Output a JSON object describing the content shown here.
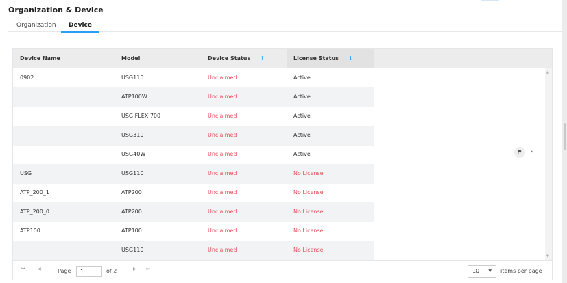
{
  "page": {
    "title": "Organization & Device"
  },
  "tabs": [
    {
      "label": "Organization",
      "active": false
    },
    {
      "label": "Device",
      "active": true
    }
  ],
  "table": {
    "columns": {
      "device_name": "Device Name",
      "model": "Model",
      "device_status": "Device Status",
      "license_status": "License Status"
    },
    "sort": {
      "device_status": "↑",
      "license_status": "↓"
    },
    "rows": [
      {
        "device_name": "0902",
        "model": "USG110",
        "device_status": "Unclaimed",
        "license_status": "Active"
      },
      {
        "device_name": "",
        "model": "ATP100W",
        "device_status": "Unclaimed",
        "license_status": "Active"
      },
      {
        "device_name": "",
        "model": "USG FLEX 700",
        "device_status": "Unclaimed",
        "license_status": "Active"
      },
      {
        "device_name": "",
        "model": "USG310",
        "device_status": "Unclaimed",
        "license_status": "Active"
      },
      {
        "device_name": "",
        "model": "USG40W",
        "device_status": "Unclaimed",
        "license_status": "Active"
      },
      {
        "device_name": "USG",
        "model": "USG110",
        "device_status": "Unclaimed",
        "license_status": "No License"
      },
      {
        "device_name": "ATP_200_1",
        "model": "ATP200",
        "device_status": "Unclaimed",
        "license_status": "No License"
      },
      {
        "device_name": "ATP_200_0",
        "model": "ATP200",
        "device_status": "Unclaimed",
        "license_status": "No License"
      },
      {
        "device_name": "ATP100",
        "model": "ATP100",
        "device_status": "Unclaimed",
        "license_status": "No License"
      },
      {
        "device_name": "",
        "model": "USG110",
        "device_status": "Unclaimed",
        "license_status": "No License"
      }
    ]
  },
  "side_actions": {
    "flag_icon": "⚑",
    "next_icon": "›"
  },
  "pagination": {
    "first_icon": "⏮",
    "prev_icon": "◀",
    "next_icon": "▶",
    "last_icon": "⏭",
    "page_label": "Page",
    "page_value": "1",
    "of_label": "of 2",
    "items_per_page_value": "10",
    "items_per_page_label": "items per page"
  },
  "colors": {
    "accent": "#2a9df4",
    "status_red": "#e8505b"
  }
}
